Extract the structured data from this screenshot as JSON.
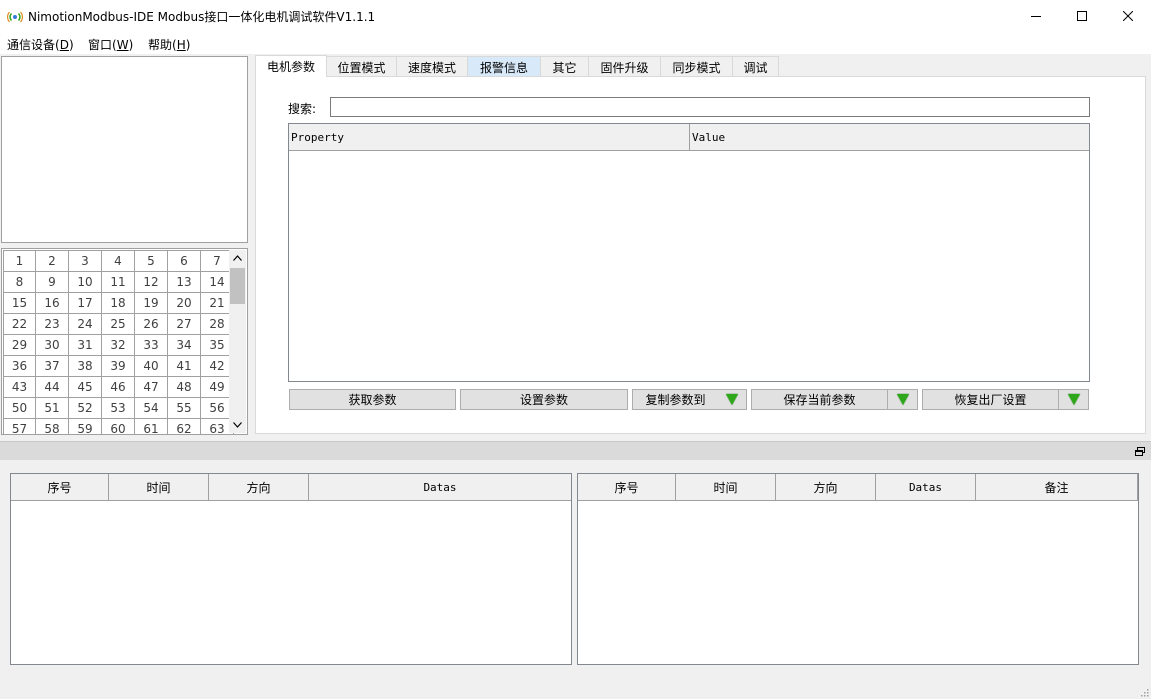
{
  "window": {
    "title": "NimotionModbus-IDE Modbus接口一体化电机调试软件V1.1.1",
    "icon": "app-signal-icon",
    "controls": [
      "minimize-icon",
      "maximize-icon",
      "close-icon"
    ]
  },
  "menu": {
    "items": [
      {
        "label": "通信设备(",
        "key": "D",
        "suffix": ")"
      },
      {
        "label": "窗口(",
        "key": "W",
        "suffix": ")"
      },
      {
        "label": "帮助(",
        "key": "H",
        "suffix": ")"
      }
    ]
  },
  "num_grid": {
    "rows": [
      [
        "1",
        "2",
        "3",
        "4",
        "5",
        "6",
        "7"
      ],
      [
        "8",
        "9",
        "10",
        "11",
        "12",
        "13",
        "14"
      ],
      [
        "15",
        "16",
        "17",
        "18",
        "19",
        "20",
        "21"
      ],
      [
        "22",
        "23",
        "24",
        "25",
        "26",
        "27",
        "28"
      ],
      [
        "29",
        "30",
        "31",
        "32",
        "33",
        "34",
        "35"
      ],
      [
        "36",
        "37",
        "38",
        "39",
        "40",
        "41",
        "42"
      ],
      [
        "43",
        "44",
        "45",
        "46",
        "47",
        "48",
        "49"
      ],
      [
        "50",
        "51",
        "52",
        "53",
        "54",
        "55",
        "56"
      ],
      [
        "57",
        "58",
        "59",
        "60",
        "61",
        "62",
        "63"
      ]
    ]
  },
  "tabs": [
    {
      "label": "电机参数",
      "active": true
    },
    {
      "label": "位置模式"
    },
    {
      "label": "速度模式"
    },
    {
      "label": "报警信息"
    },
    {
      "label": "其它"
    },
    {
      "label": "固件升级"
    },
    {
      "label": "同步模式"
    },
    {
      "label": "调试"
    }
  ],
  "params": {
    "search_label": "搜索:",
    "search_value": "",
    "grid_headers": [
      "Property",
      "Value"
    ],
    "buttons": {
      "get": "获取参数",
      "set": "设置参数",
      "copy": "复制参数到",
      "save": "保存当前参数",
      "restore": "恢复出厂设置"
    }
  },
  "log_left": {
    "headers": [
      "序号",
      "时间",
      "方向",
      "Datas"
    ]
  },
  "log_right": {
    "headers": [
      "序号",
      "时间",
      "方向",
      "Datas",
      "备注"
    ]
  },
  "colors": {
    "dropdown_arrow": "#2ea81a",
    "hover_tab": "#d8eaf9"
  }
}
